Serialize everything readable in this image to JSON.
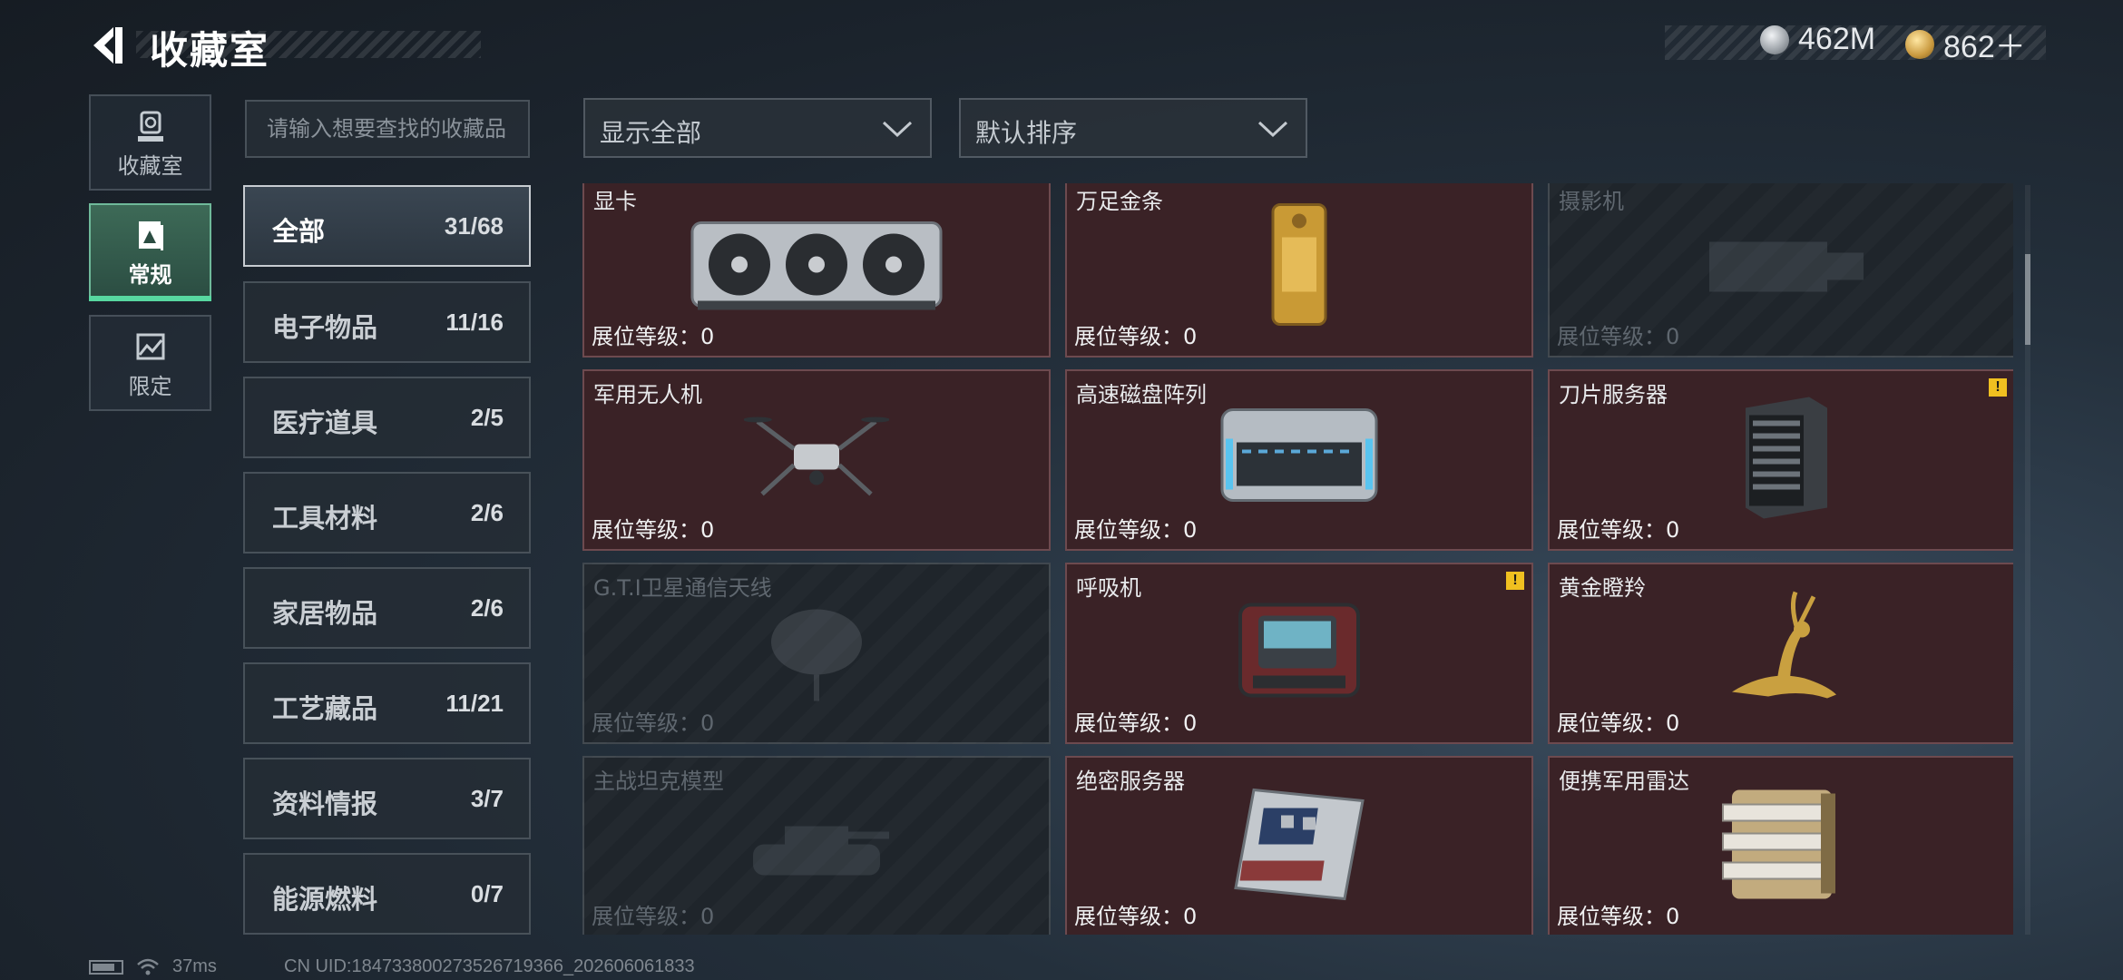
{
  "header": {
    "title": "收藏室"
  },
  "currency": {
    "silver": "462M",
    "gold": "862＋"
  },
  "nav": [
    {
      "label": "收藏室",
      "icon": "trophy-icon"
    },
    {
      "label": "常规",
      "icon": "frame-icon",
      "active": true
    },
    {
      "label": "限定",
      "icon": "image-icon"
    }
  ],
  "search": {
    "placeholder": "请输入想要查找的收藏品"
  },
  "filters": {
    "display": "显示全部",
    "sort": "默认排序"
  },
  "categories": [
    {
      "name": "全部",
      "count": "31/68",
      "active": true
    },
    {
      "name": "电子物品",
      "count": "11/16"
    },
    {
      "name": "医疗道具",
      "count": "2/5"
    },
    {
      "name": "工具材料",
      "count": "2/6"
    },
    {
      "name": "家居物品",
      "count": "2/6"
    },
    {
      "name": "工艺藏品",
      "count": "11/21"
    },
    {
      "name": "资料情报",
      "count": "3/7"
    },
    {
      "name": "能源燃料",
      "count": "0/7"
    }
  ],
  "level_label": "展位等级：0",
  "items": [
    {
      "name": "显卡",
      "locked": false,
      "art": "gpu",
      "warn": false
    },
    {
      "name": "万足金条",
      "locked": false,
      "art": "gold-bar",
      "warn": false
    },
    {
      "name": "摄影机",
      "locked": true,
      "art": "camera",
      "warn": false
    },
    {
      "name": "军用无人机",
      "locked": false,
      "art": "drone",
      "warn": false
    },
    {
      "name": "高速磁盘阵列",
      "locked": false,
      "art": "disk-array",
      "warn": false
    },
    {
      "name": "刀片服务器",
      "locked": false,
      "art": "blade-server",
      "warn": true
    },
    {
      "name": "G.T.I卫星通信天线",
      "locked": true,
      "art": "antenna",
      "warn": false
    },
    {
      "name": "呼吸机",
      "locked": false,
      "art": "ventilator",
      "warn": true
    },
    {
      "name": "黄金瞪羚",
      "locked": false,
      "art": "gazelle",
      "warn": false
    },
    {
      "name": "主战坦克模型",
      "locked": true,
      "art": "tank",
      "warn": false
    },
    {
      "name": "绝密服务器",
      "locked": false,
      "art": "server",
      "warn": false
    },
    {
      "name": "便携军用雷达",
      "locked": false,
      "art": "radar",
      "warn": false
    }
  ],
  "status": {
    "ping": "37ms",
    "uid": "CN UID:1847338002735267193​66_202606061833"
  },
  "colors": {
    "accent": "#57d7a0",
    "owned_card": "#3a2226",
    "warning": "#f0c020"
  }
}
